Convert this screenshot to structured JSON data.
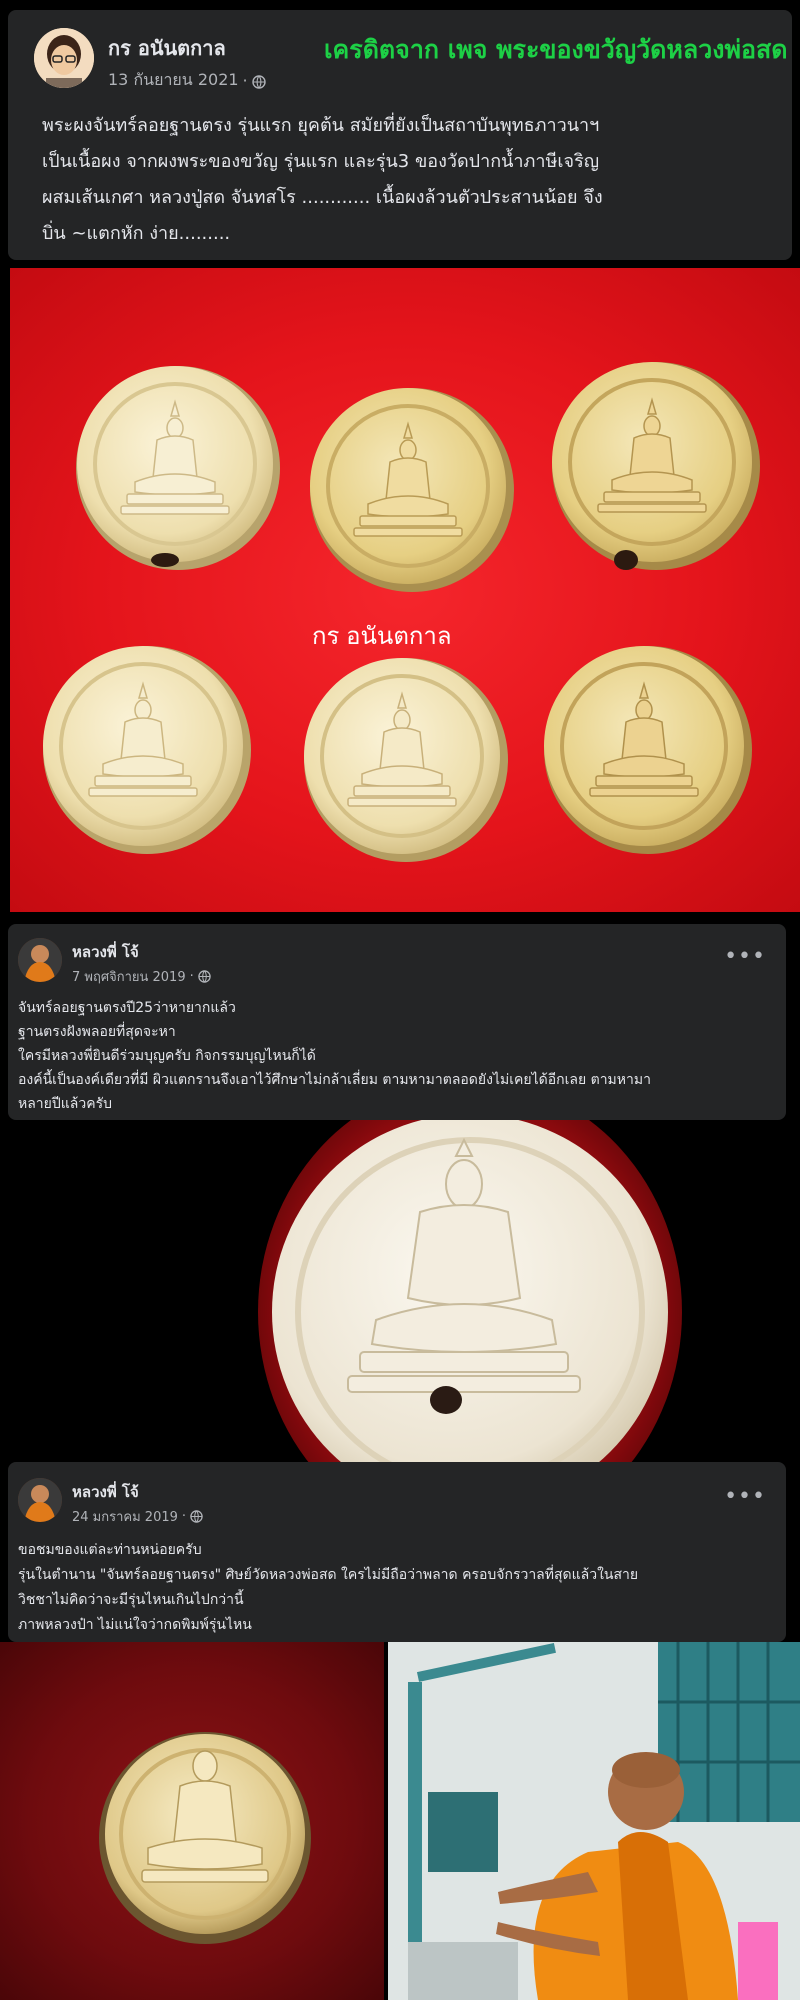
{
  "post1": {
    "author": "กร อนันตกาล",
    "date": "13 กันยายน 2021",
    "credit": "เครดิตจาก เพจ พระของขวัญวัดหลวงพ่อสด",
    "lines": [
      "พระผงจันทร์ลอยฐานตรง รุ่นแรก  ยุคต้น  สมัยที่ยังเป็นสถาบันพุทธภาวนาฯ",
      "เป็นเนื้อผง จากผงพระของขวัญ รุ่นแรก และรุ่น3  ของวัดปากน้ำภาษีเจริญ",
      "ผสมเส้นเกศา หลวงปู่สด จันทสโร  ............ เนื้อผงล้วนตัวประสานน้อย จึง",
      "บิ่น ~แตกหัก ง่าย........."
    ]
  },
  "photo1": {
    "watermark": "กร อนันตกาล"
  },
  "post2": {
    "author": "หลวงพี่ โจ้",
    "date": "7 พฤศจิกายน 2019",
    "lines": [
      "จันทร์ลอยฐานตรงปี25ว่าหายากแล้ว",
      "ฐานตรงฝังพลอยที่สุดจะหา",
      "ใครมีหลวงพี่ยินดีร่วมบุญครับ กิจกรรมบุญไหนก็ได้",
      "องค์นี้เป็นองค์เดียวที่มี ผิวแตกรานจึงเอาไว้ศึกษาไม่กล้าเลี่ยม ตามหามาตลอดยังไม่เคยได้อีกเลย ตามหามา",
      "หลายปีแล้วครับ"
    ]
  },
  "post3": {
    "author": "หลวงพี่ โจ้",
    "date": "24 มกราคม 2019",
    "lines": [
      "ขอชมของแต่ละท่านหน่อยครับ",
      "รุ่นในตำนาน \"จันทร์ลอยฐานตรง\" ศิษย์วัดหลวงพ่อสด ใครไม่มีถือว่าพลาด ครอบจักรวาลที่สุดแล้วในสาย",
      "วิชชาไม่คิดว่าจะมีรุ่นไหนเกินไปกว่านี้",
      "ภาพหลวงป๋า ไม่แน่ใจว่ากดพิมพ์รุ่นไหน"
    ]
  },
  "icons": {
    "globe": "globe-icon",
    "more": "more-options-icon",
    "more_glyph": "•••",
    "dot_separator": "·"
  },
  "colors": {
    "card_bg": "#242526",
    "text_primary": "#e4e6eb",
    "text_secondary": "#b0b3b8",
    "credit_green": "#1dd146",
    "cloth_red": "#e4141b"
  }
}
